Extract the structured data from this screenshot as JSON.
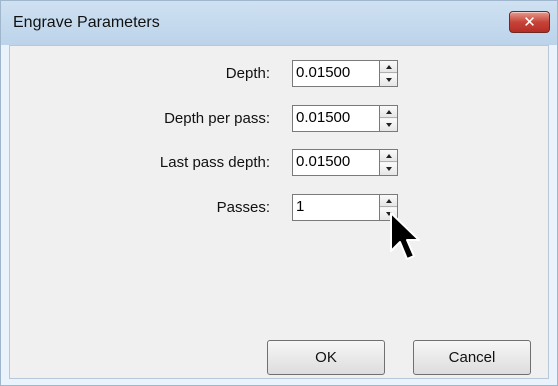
{
  "window": {
    "title": "Engrave Parameters",
    "close_glyph": "✕"
  },
  "fields": [
    {
      "label": "Depth:",
      "value": "0.01500"
    },
    {
      "label": "Depth per pass:",
      "value": "0.01500"
    },
    {
      "label": "Last pass depth:",
      "value": "0.01500"
    },
    {
      "label": "Passes:",
      "value": "1"
    }
  ],
  "buttons": {
    "ok": "OK",
    "cancel": "Cancel"
  },
  "icons": {
    "close": "close-icon",
    "spin_up": "chevron-up-icon",
    "spin_down": "chevron-down-icon",
    "cursor": "mouse-pointer-icon"
  },
  "colors": {
    "title_bar": "#c6dcf0",
    "close_button": "#c7443a",
    "dialog_background": "#f0f0f0"
  }
}
